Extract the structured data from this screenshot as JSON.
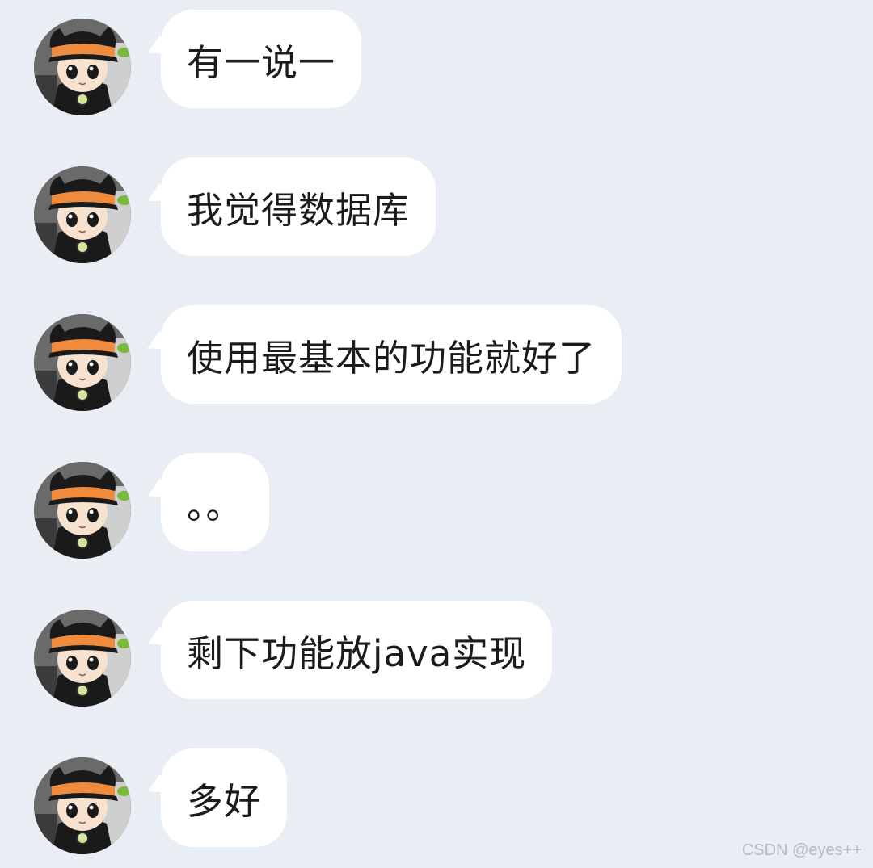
{
  "chat": {
    "messages": [
      {
        "avatar_icon": "cartoon-character-avatar-icon",
        "text": "有一说一"
      },
      {
        "avatar_icon": "cartoon-character-avatar-icon",
        "text": "我觉得数据库"
      },
      {
        "avatar_icon": "cartoon-character-avatar-icon",
        "text": "使用最基本的功能就好了"
      },
      {
        "avatar_icon": "cartoon-character-avatar-icon",
        "text": "。。"
      },
      {
        "avatar_icon": "cartoon-character-avatar-icon",
        "text": "剩下功能放java实现"
      },
      {
        "avatar_icon": "cartoon-character-avatar-icon",
        "text": "多好"
      }
    ]
  },
  "watermark": {
    "text": "CSDN @eyes++"
  },
  "colors": {
    "background": "#e9edf4",
    "bubble": "#ffffff",
    "hat_orange": "#f08a3c",
    "hat_black": "#1a1a1a"
  }
}
